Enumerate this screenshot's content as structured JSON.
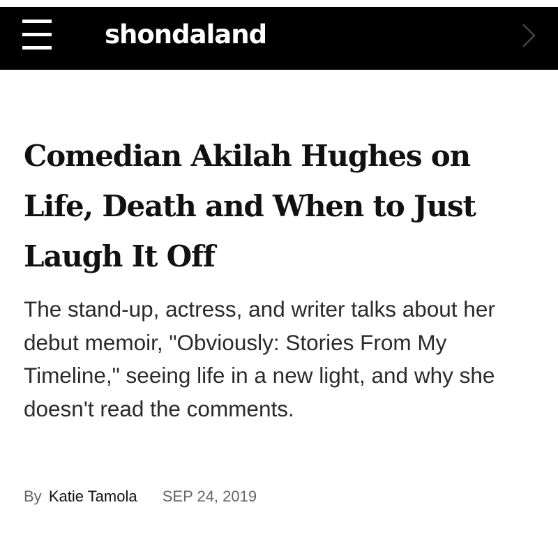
{
  "header": {
    "menu_icon": "hamburger-menu-icon",
    "brand": "shondaland",
    "next_icon": "chevron-right-icon",
    "background_color": "#000000",
    "brand_color": "#ffffff"
  },
  "article": {
    "headline": "Comedian Akilah Hughes on Life, Death and When to Just Laugh It Off",
    "dek": "The stand-up, actress, and writer talks about her debut memoir, \"Obviously: Stories From My Timeline,\" seeing life in a new light, and why she doesn't read the comments.",
    "byline": {
      "by_label": "By",
      "author": "Katie Tamola",
      "date": "SEP 24, 2019"
    }
  }
}
